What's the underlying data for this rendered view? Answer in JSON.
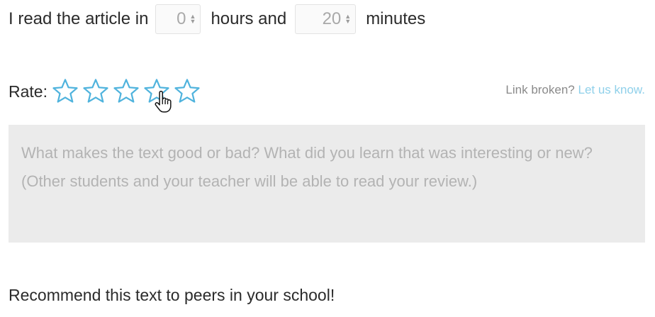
{
  "time": {
    "prefix": "I read the article in",
    "hours_value": "0",
    "hours_label": "hours and",
    "minutes_value": "20",
    "minutes_label": "minutes"
  },
  "rating": {
    "label": "Rate:",
    "max_stars": 5,
    "selected": 0,
    "hover_star": 4,
    "star_color": "#4fb3dd",
    "icons": [
      "star-outline-icon",
      "hand-pointer-icon"
    ]
  },
  "link_broken": {
    "text": "Link broken?",
    "link_text": "Let us know.",
    "link_color": "#8fd0ea"
  },
  "review": {
    "value": "",
    "placeholder": "What makes the text good or bad? What did you learn that was interesting or new? (Other students and your teacher will be able to read your review.)"
  },
  "recommend": {
    "text": "Recommend this text to peers in your school!"
  }
}
